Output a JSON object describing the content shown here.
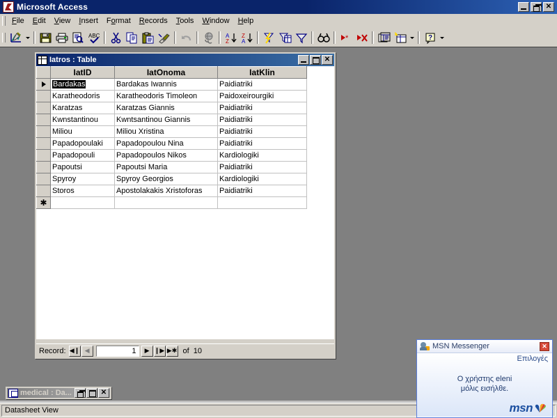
{
  "app": {
    "title": "Microsoft Access",
    "icon": "access-icon",
    "window_buttons": {
      "minimize": "_",
      "restore": "❐",
      "close": "✕"
    }
  },
  "menubar": {
    "items": [
      {
        "label": "File",
        "accel": "F"
      },
      {
        "label": "Edit",
        "accel": "E"
      },
      {
        "label": "View",
        "accel": "V"
      },
      {
        "label": "Insert",
        "accel": "I"
      },
      {
        "label": "Format",
        "accel": "o"
      },
      {
        "label": "Records",
        "accel": "R"
      },
      {
        "label": "Tools",
        "accel": "T"
      },
      {
        "label": "Window",
        "accel": "W"
      },
      {
        "label": "Help",
        "accel": "H"
      }
    ]
  },
  "toolbar": {
    "buttons": [
      {
        "name": "view-design-icon",
        "title": "View"
      },
      {
        "name": "view-dropdown-arrow",
        "title": "View options"
      },
      {
        "name": "save-icon",
        "title": "Save"
      },
      {
        "name": "print-icon",
        "title": "Print"
      },
      {
        "name": "print-preview-icon",
        "title": "Print Preview"
      },
      {
        "name": "spelling-icon",
        "title": "Spelling"
      },
      {
        "name": "cut-icon",
        "title": "Cut"
      },
      {
        "name": "copy-icon",
        "title": "Copy"
      },
      {
        "name": "paste-icon",
        "title": "Paste"
      },
      {
        "name": "format-painter-icon",
        "title": "Format Painter"
      },
      {
        "name": "undo-icon",
        "title": "Undo"
      },
      {
        "name": "insert-hyperlink-icon",
        "title": "Insert Hyperlink"
      },
      {
        "name": "sort-ascending-icon",
        "title": "Sort Ascending"
      },
      {
        "name": "sort-descending-icon",
        "title": "Sort Descending"
      },
      {
        "name": "filter-by-selection-icon",
        "title": "Filter By Selection"
      },
      {
        "name": "filter-by-form-icon",
        "title": "Filter By Form"
      },
      {
        "name": "apply-filter-icon",
        "title": "Apply Filter"
      },
      {
        "name": "find-icon",
        "title": "Find"
      },
      {
        "name": "new-record-icon",
        "title": "New Record"
      },
      {
        "name": "delete-record-icon",
        "title": "Delete Record"
      },
      {
        "name": "database-window-icon",
        "title": "Database Window"
      },
      {
        "name": "new-object-icon",
        "title": "New Object"
      },
      {
        "name": "new-object-dropdown-arrow",
        "title": "New Object options"
      },
      {
        "name": "help-icon",
        "title": "Microsoft Access Help"
      },
      {
        "name": "help-dropdown-arrow",
        "title": "Help options"
      }
    ]
  },
  "table_window": {
    "title": "Iatros : Table",
    "icon": "datasheet-icon",
    "buttons": {
      "minimize": "_",
      "maximize": "❐",
      "close": "✕"
    },
    "columns": [
      "",
      "IatID",
      "IatOnoma",
      "IatKlin"
    ],
    "rows": [
      {
        "selector": "current",
        "IatID": "Bardakas",
        "IatOnoma": "Bardakas Iwannis",
        "IatKlin": "Paidiatriki",
        "selected_cell": "IatID"
      },
      {
        "selector": "",
        "IatID": "Karatheodoris",
        "IatOnoma": "Karatheodoris Timoleon",
        "IatKlin": "Paidoxeirourgiki"
      },
      {
        "selector": "",
        "IatID": "Karatzas",
        "IatOnoma": "Karatzas Giannis",
        "IatKlin": "Paidiatriki"
      },
      {
        "selector": "",
        "IatID": "Kwnstantinou",
        "IatOnoma": "Kwntsantinou Giannis",
        "IatKlin": "Paidiatriki"
      },
      {
        "selector": "",
        "IatID": "Miliou",
        "IatOnoma": "Miliou Xristina",
        "IatKlin": "Paidiatriki"
      },
      {
        "selector": "",
        "IatID": "Papadopoulaki",
        "IatOnoma": "Papadopoulou Nina",
        "IatKlin": "Paidiatriki"
      },
      {
        "selector": "",
        "IatID": "Papadopouli",
        "IatOnoma": "Papadopoulos Nikos",
        "IatKlin": "Kardiologiki"
      },
      {
        "selector": "",
        "IatID": "Papoutsi",
        "IatOnoma": "Papoutsi Maria",
        "IatKlin": "Paidiatriki"
      },
      {
        "selector": "",
        "IatID": "Spyroy",
        "IatOnoma": "Spyroy Georgios",
        "IatKlin": "Kardiologiki"
      },
      {
        "selector": "",
        "IatID": "Storos",
        "IatOnoma": "Apostolakakis Xristoforas",
        "IatKlin": "Paidiatriki"
      },
      {
        "selector": "new",
        "IatID": "",
        "IatOnoma": "",
        "IatKlin": ""
      }
    ],
    "record_nav": {
      "label": "Record:",
      "first": "◀❙",
      "previous": "◀",
      "current": "1",
      "next": "▶",
      "last": "❙▶",
      "new": "▶✱",
      "of_label": "of",
      "total": "10"
    }
  },
  "minimized_window": {
    "title": "medical : Da...",
    "icon": "database-icon",
    "buttons": {
      "restore": "❐",
      "maximize": "❐",
      "close": "✕"
    }
  },
  "statusbar": {
    "message": "Datasheet View",
    "panels": [
      "",
      ""
    ]
  },
  "msn": {
    "title": "MSN Messenger",
    "icon": "msn-contact-icon",
    "close": "✕",
    "options_link": "Επιλογές",
    "message_line1": "Ο χρήστης eleni",
    "message_line2": "μόλις εισήλθε.",
    "logo_text": "msn"
  },
  "colors": {
    "title_bar_start": "#0a246a",
    "title_bar_end": "#2d62b5",
    "face": "#d4d0c8",
    "mdi_background": "#808080",
    "msn_accent": "#1b4fa0",
    "msn_close": "#d64a38"
  }
}
